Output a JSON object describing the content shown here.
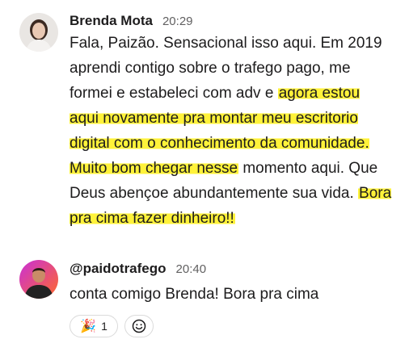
{
  "messages": [
    {
      "author": "Brenda Mota",
      "time": "20:29",
      "avatar_icon": "user-avatar-brenda",
      "text_plain_1": "Fala, Paizão. Sensacional isso aqui. Em 2019 aprendi contigo sobre o trafego pago, me formei e estabeleci com adv e ",
      "text_highlight_1": "agora estou aqui novamente pra montar meu escritorio digital com o conhecimento da comunidade. Muito bom chegar nesse",
      "text_plain_2": " momento aqui. Que Deus abençoe abundantemente sua vida. ",
      "text_highlight_2": "Bora pra cima fazer dinheiro!!"
    },
    {
      "author": "@paidotrafego",
      "time": "20:40",
      "avatar_icon": "user-avatar-paidotrafego",
      "text": "conta comigo Brenda! Bora pra cima",
      "reactions": [
        {
          "icon": "party-popper-icon",
          "emoji": "🎉",
          "count": "1"
        },
        {
          "icon": "add-reaction-icon"
        }
      ]
    }
  ],
  "colors": {
    "highlight": "#fff23a",
    "text": "#1d1c1d",
    "muted": "#616061"
  }
}
